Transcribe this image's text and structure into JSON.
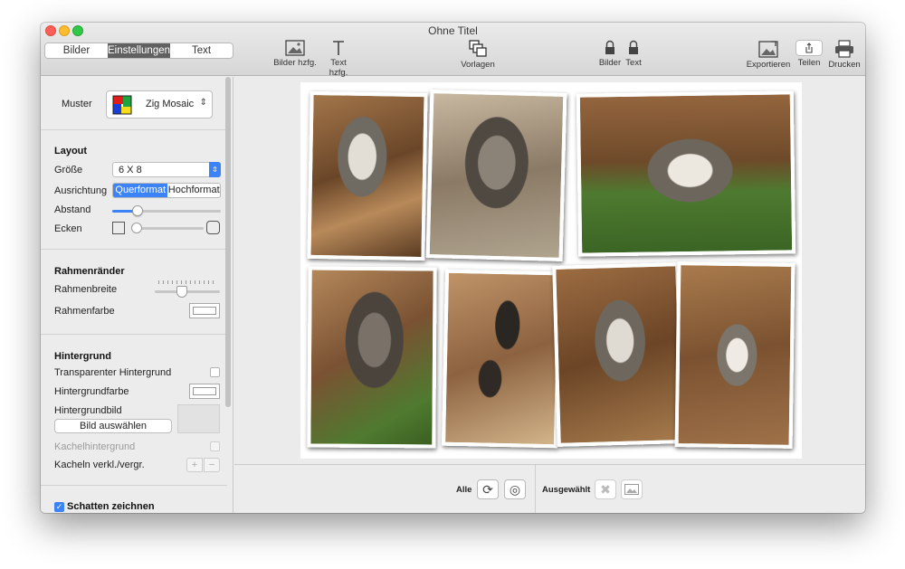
{
  "window": {
    "title": "Ohne Titel"
  },
  "tabs": [
    {
      "label": "Bilder"
    },
    {
      "label": "Einstellungen"
    },
    {
      "label": "Text"
    }
  ],
  "toolbar": {
    "images_shuffle": "Bilder hzfg.",
    "text_shuffle": "Text hzfg.",
    "templates": "Vorlagen",
    "lock_images": "Bilder",
    "lock_text": "Text",
    "export": "Exportieren",
    "share": "Teilen",
    "print": "Drucken"
  },
  "sidebar": {
    "pattern": {
      "label": "Muster",
      "value": "Zig Mosaic"
    },
    "layout": {
      "title": "Layout",
      "size_label": "Größe",
      "size_value": "6 X 8",
      "orientation_label": "Ausrichtung",
      "landscape": "Querformat",
      "portrait": "Hochformat",
      "spacing_label": "Abstand",
      "spacing_value": 0.2,
      "corners_label": "Ecken",
      "corners_value": 0.0
    },
    "borders": {
      "title": "Rahmenränder",
      "width_label": "Rahmenbreite",
      "width_value": 0.4,
      "color_label": "Rahmenfarbe"
    },
    "background": {
      "title": "Hintergrund",
      "transparent_label": "Transparenter Hintergrund",
      "color_label": "Hintergrundfarbe",
      "image_label": "Hintergrundbild",
      "choose_button": "Bild auswählen",
      "tile_label": "Kachelhintergrund",
      "tile_scale_label": "Kacheln verkl./vergr."
    },
    "shadow": {
      "label": "Schatten zeichnen",
      "checked": true
    }
  },
  "bottom": {
    "all_label": "Alle",
    "selected_label": "Ausgewählt"
  },
  "colors": {
    "accent": "#3b83f7",
    "segment_selected": "#616161",
    "wood": "#8a5a34",
    "grass": "#4e7a30"
  }
}
